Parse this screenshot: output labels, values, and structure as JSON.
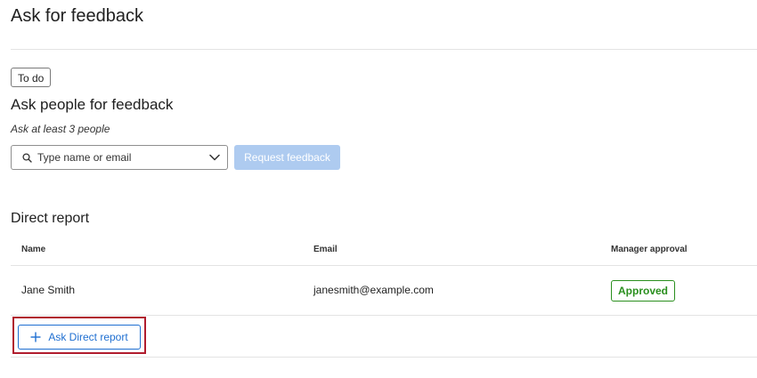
{
  "page": {
    "title": "Ask for feedback"
  },
  "todo_tag": "To do",
  "ask_section": {
    "heading": "Ask people for feedback",
    "helper": "Ask at least 3 people",
    "search": {
      "placeholder": "Type name or email",
      "value": ""
    },
    "request_button": "Request feedback"
  },
  "direct_report": {
    "heading": "Direct report",
    "columns": {
      "name": "Name",
      "email": "Email",
      "approval": "Manager approval"
    },
    "rows": [
      {
        "name": "Jane Smith",
        "email": "janesmith@example.com",
        "approval": "Approved"
      }
    ],
    "add_button": "Ask Direct report"
  },
  "colors": {
    "primary": "#1f6fd1",
    "disabled_button": "#aecbf0",
    "approved": "#2a8f1e",
    "highlight": "#b01c2e"
  },
  "icons": {
    "search": "search-icon",
    "dropdown": "chevron-down-icon",
    "add": "plus-icon"
  }
}
